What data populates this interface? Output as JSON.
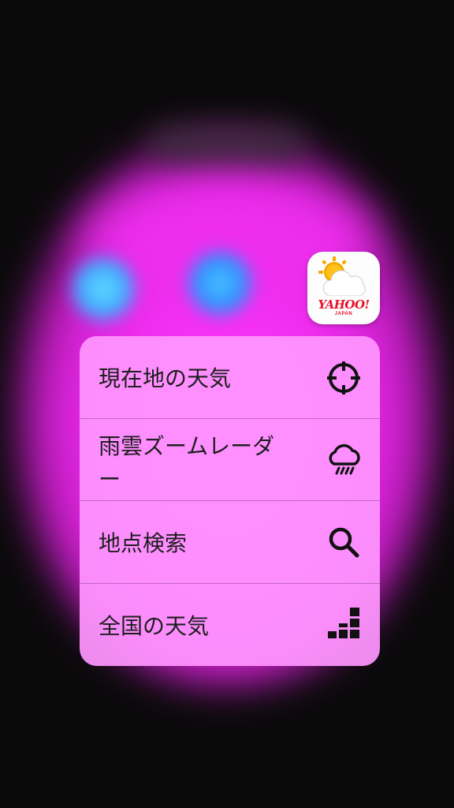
{
  "app": {
    "brand": "YAHOO!",
    "brand_sub": "JAPAN",
    "icon": "weather-sun-cloud-icon"
  },
  "quick_actions": [
    {
      "label": "現在地の天気",
      "icon": "crosshair-icon"
    },
    {
      "label": "雨雲ズームレーダ\nー",
      "icon": "rain-cloud-icon"
    },
    {
      "label": "地点検索",
      "icon": "search-icon"
    },
    {
      "label": "全国の天気",
      "icon": "japan-map-icon"
    }
  ],
  "colors": {
    "menu_background": "#ff96ff",
    "glow": "#ff39ff",
    "brand_red": "#e8102a",
    "sun": "#f7a800"
  }
}
